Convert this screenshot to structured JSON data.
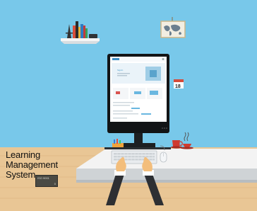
{
  "caption": {
    "line1": "Learning",
    "line2": "Management",
    "line3": "System"
  },
  "badge": {
    "text": "ISO 9001",
    "small": "0"
  },
  "calendar": {
    "day": "18"
  },
  "screen": {
    "heading": "Signin"
  },
  "colors": {
    "sky": "#78c8ea",
    "desk": "#e8c28e",
    "counter": "#f2f2f2",
    "monitor": "#111111"
  }
}
